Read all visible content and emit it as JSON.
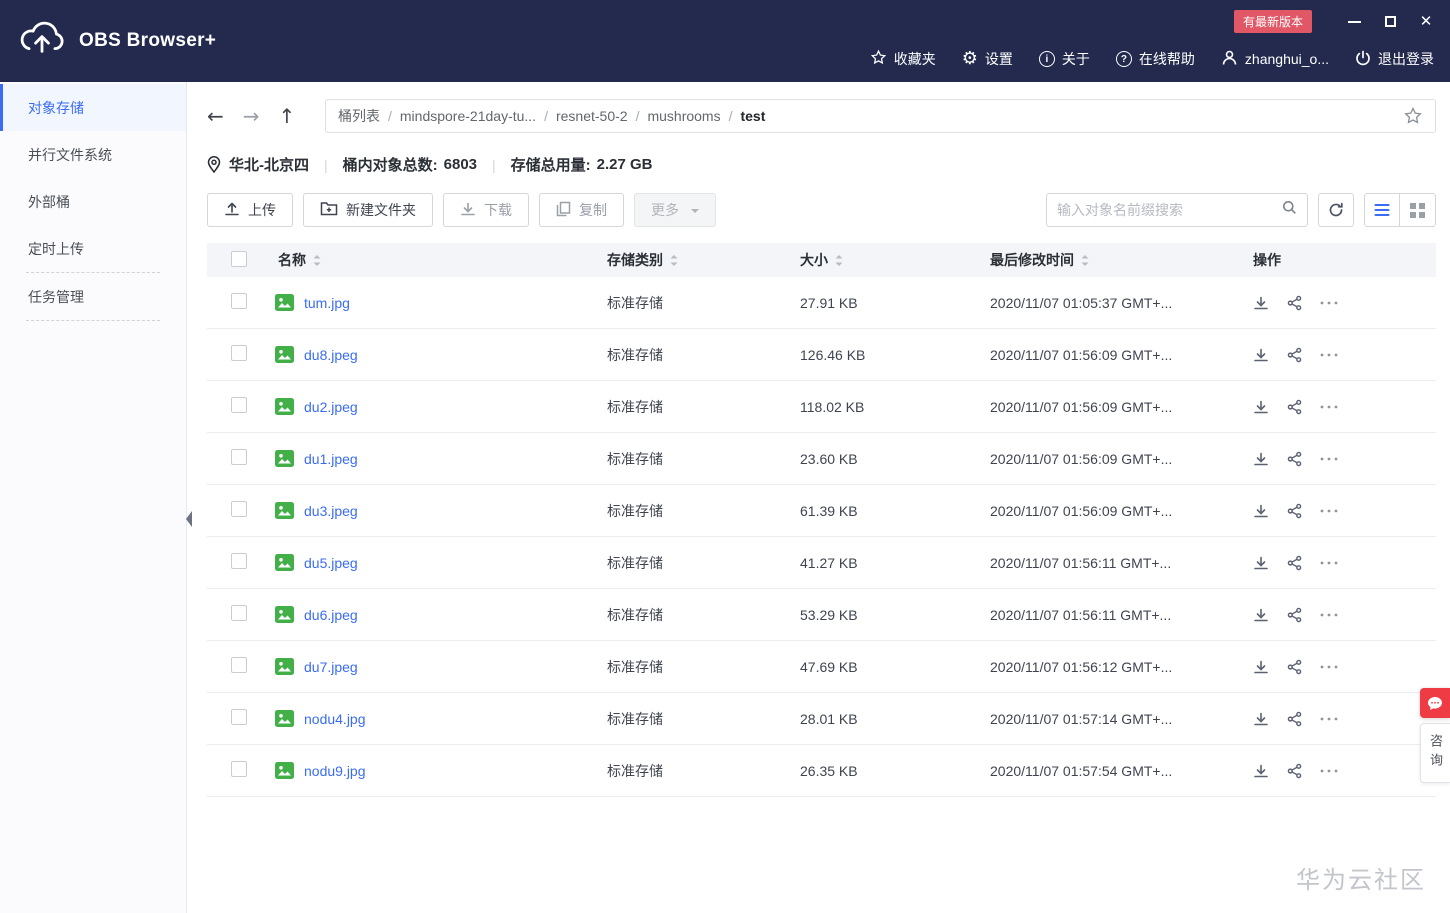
{
  "window": {
    "title": "OBS Browser+",
    "update_badge": "有最新版本"
  },
  "topbar": {
    "menu": [
      {
        "label": "收藏夹"
      },
      {
        "label": "设置"
      },
      {
        "label": "关于"
      },
      {
        "label": "在线帮助"
      },
      {
        "label": "zhanghui_o..."
      },
      {
        "label": "退出登录"
      }
    ]
  },
  "sidebar": {
    "items": [
      {
        "label": "对象存储",
        "active": true
      },
      {
        "label": "并行文件系统",
        "active": false
      },
      {
        "label": "外部桶",
        "active": false
      },
      {
        "label": "定时上传",
        "active": false
      },
      {
        "label": "任务管理",
        "active": false
      }
    ]
  },
  "nav": {
    "separator": "/",
    "breadcrumb": [
      "桶列表",
      "mindspore-21day-tu...",
      "resnet-50-2",
      "mushrooms",
      "test"
    ]
  },
  "bucket_info": {
    "region": "华北-北京四",
    "objects_label": "桶内对象总数:",
    "objects_count": "6803",
    "storage_label": "存储总用量:",
    "storage_value": "2.27 GB"
  },
  "toolbar": {
    "upload": "上传",
    "new_folder": "新建文件夹",
    "download": "下载",
    "copy": "复制",
    "more": "更多",
    "search_placeholder": "输入对象名前缀搜索"
  },
  "table": {
    "headers": {
      "name": "名称",
      "storage_class": "存储类别",
      "size": "大小",
      "modified": "最后修改时间",
      "actions": "操作"
    },
    "rows": [
      {
        "name": "tum.jpg",
        "storage_class": "标准存储",
        "size": "27.91 KB",
        "modified": "2020/11/07 01:05:37 GMT+..."
      },
      {
        "name": "du8.jpeg",
        "storage_class": "标准存储",
        "size": "126.46 KB",
        "modified": "2020/11/07 01:56:09 GMT+..."
      },
      {
        "name": "du2.jpeg",
        "storage_class": "标准存储",
        "size": "118.02 KB",
        "modified": "2020/11/07 01:56:09 GMT+..."
      },
      {
        "name": "du1.jpeg",
        "storage_class": "标准存储",
        "size": "23.60 KB",
        "modified": "2020/11/07 01:56:09 GMT+..."
      },
      {
        "name": "du3.jpeg",
        "storage_class": "标准存储",
        "size": "61.39 KB",
        "modified": "2020/11/07 01:56:09 GMT+..."
      },
      {
        "name": "du5.jpeg",
        "storage_class": "标准存储",
        "size": "41.27 KB",
        "modified": "2020/11/07 01:56:11 GMT+..."
      },
      {
        "name": "du6.jpeg",
        "storage_class": "标准存储",
        "size": "53.29 KB",
        "modified": "2020/11/07 01:56:11 GMT+..."
      },
      {
        "name": "du7.jpeg",
        "storage_class": "标准存储",
        "size": "47.69 KB",
        "modified": "2020/11/07 01:56:12 GMT+..."
      },
      {
        "name": "nodu4.jpg",
        "storage_class": "标准存储",
        "size": "28.01 KB",
        "modified": "2020/11/07 01:57:14 GMT+..."
      },
      {
        "name": "nodu9.jpg",
        "storage_class": "标准存储",
        "size": "26.35 KB",
        "modified": "2020/11/07 01:57:54 GMT+..."
      }
    ]
  },
  "floating": {
    "consult": "咨询"
  },
  "watermark": "华为云社区",
  "icons": {
    "gear": "⚙",
    "close": "✕",
    "back_arrow": "←",
    "forward_arrow": "→",
    "up_arrow": "↑",
    "info": "i",
    "help": "?"
  },
  "colors": {
    "topbar_bg": "#232a4e",
    "accent_blue": "#3a6cf5",
    "badge_red": "#e15766",
    "file_icon_green": "#43af49",
    "consult_red": "#ee3b44"
  }
}
